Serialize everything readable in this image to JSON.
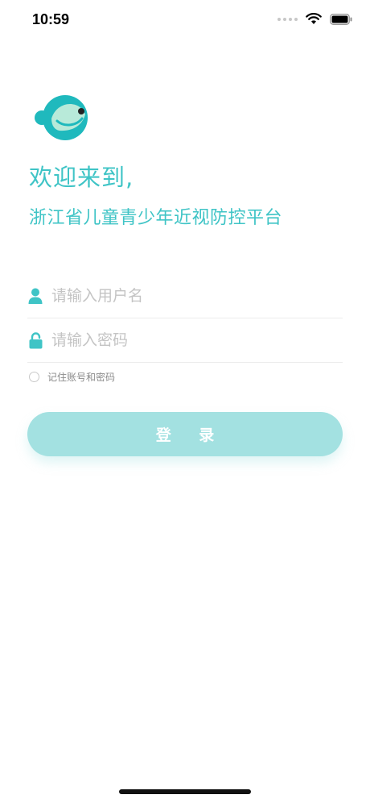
{
  "status_bar": {
    "time": "10:59"
  },
  "welcome": {
    "title": "欢迎来到,",
    "platform": "浙江省儿童青少年近视防控平台"
  },
  "login_form": {
    "username_placeholder": "请输入用户名",
    "password_placeholder": "请输入密码",
    "remember_label": "记住账号和密码",
    "remember_checked": false,
    "submit_label": "登 录"
  },
  "colors": {
    "brand": "#3fc4c6",
    "button": "#a3e1e1",
    "logo_dark": "#1fb9bd",
    "logo_light": "#b8ead9"
  },
  "icons": {
    "status": [
      "wifi-icon",
      "battery-icon"
    ],
    "fields": [
      "user-icon",
      "lock-icon"
    ]
  }
}
